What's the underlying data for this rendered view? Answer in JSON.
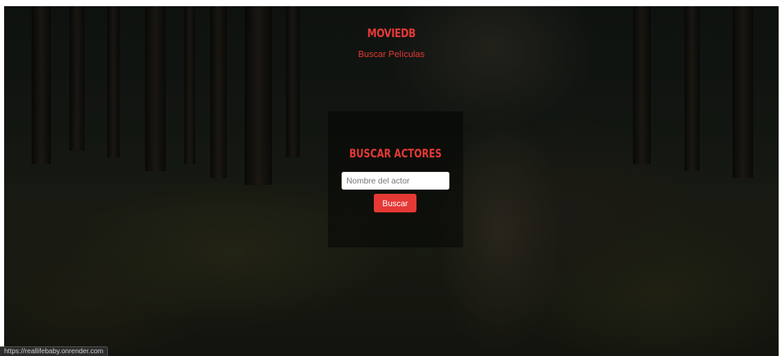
{
  "header": {
    "site_title": "MOVIEDB",
    "nav_link": "Buscar Películas"
  },
  "search_panel": {
    "title": "BUSCAR ACTORES",
    "input_placeholder": "Nombre del actor",
    "input_value": "",
    "button_label": "Buscar"
  },
  "status_bar": {
    "url": "https://reallifebaby.onrender.com"
  },
  "colors": {
    "accent": "#e53935",
    "panel_background": "rgba(0,0,0,0.42)"
  }
}
